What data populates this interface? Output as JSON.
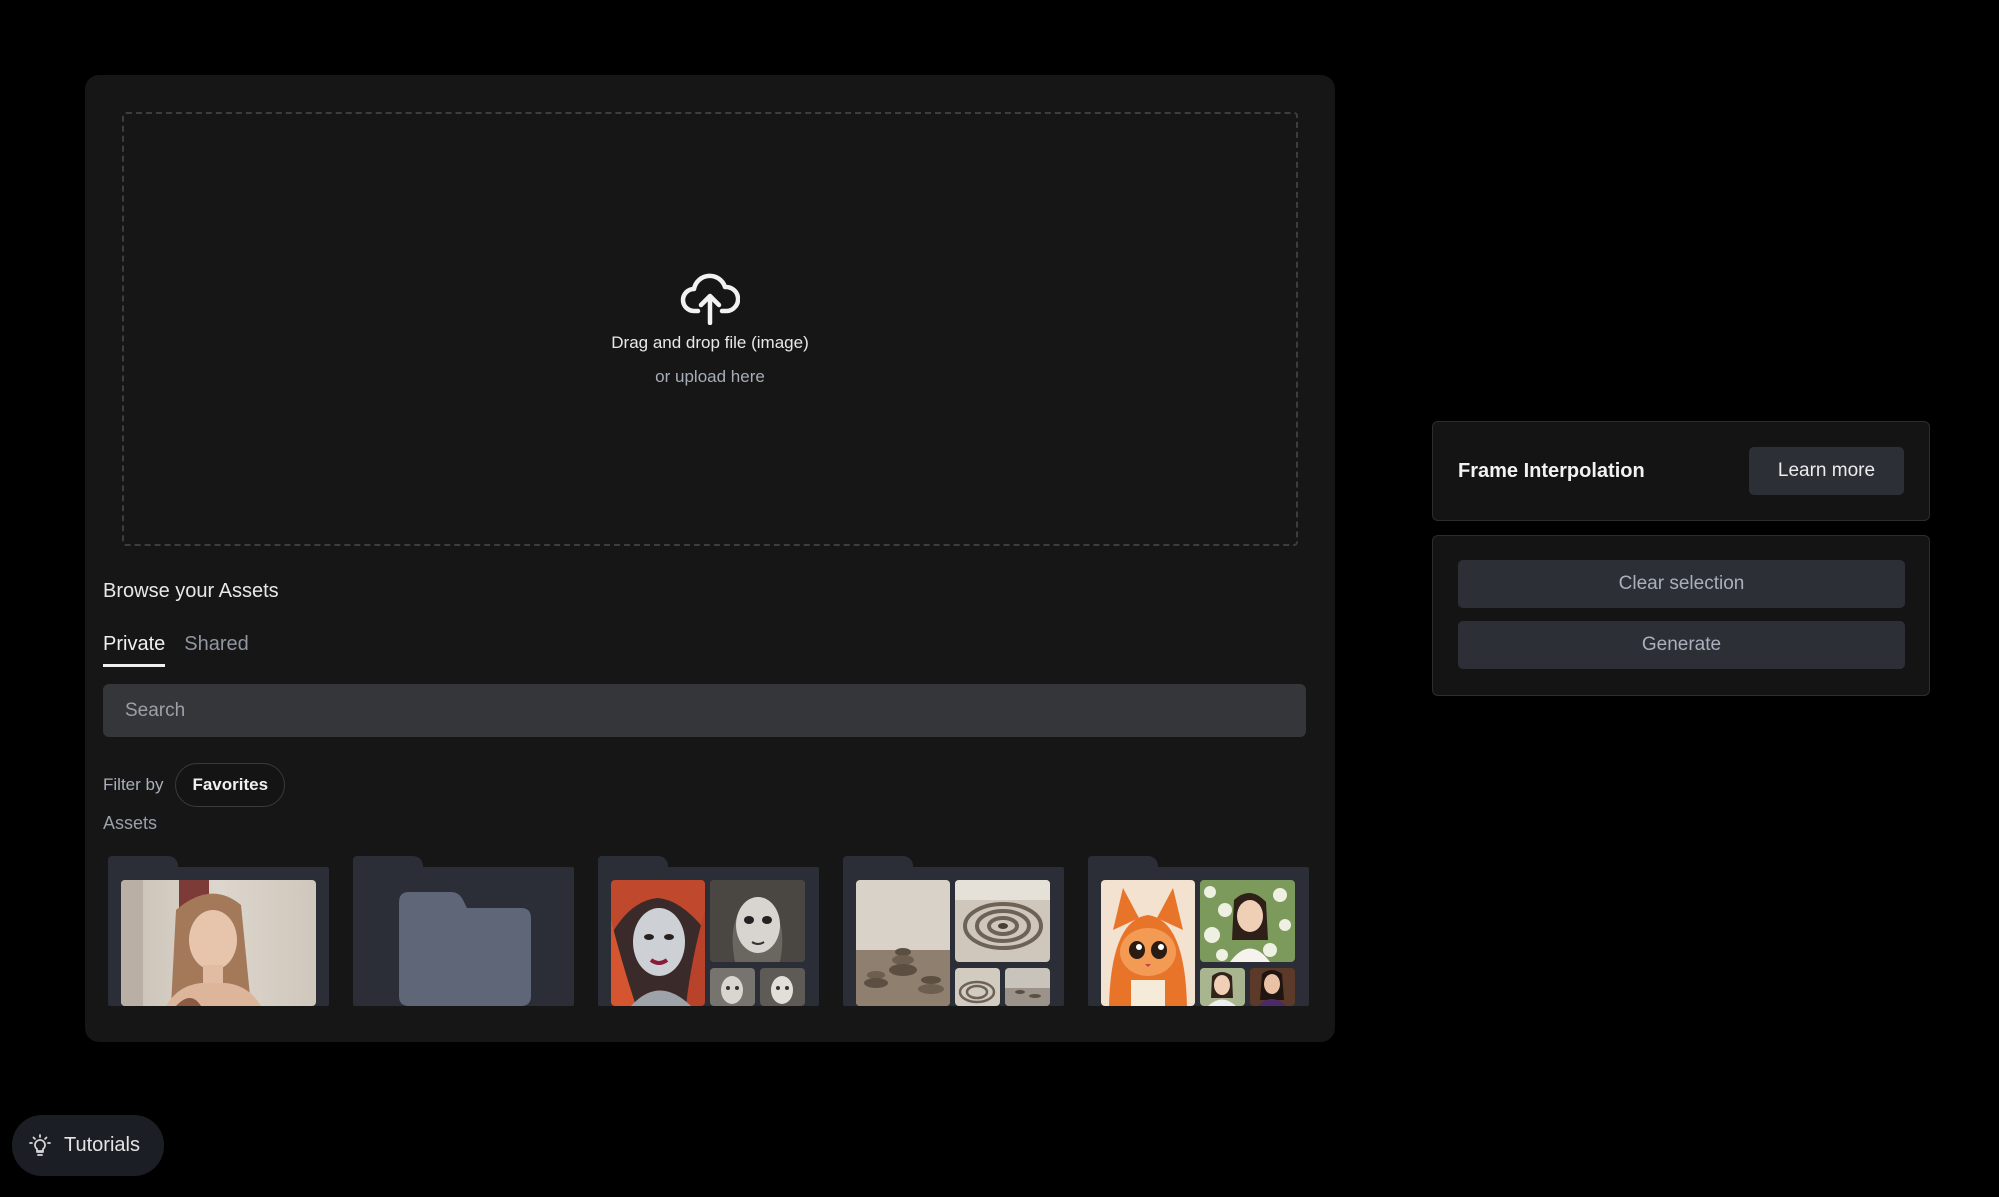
{
  "upload": {
    "title": "Drag and drop file (image)",
    "subtitle": "or upload here",
    "icon": "cloud-upload-icon"
  },
  "assets": {
    "heading": "Browse your Assets",
    "tabs": [
      {
        "label": "Private",
        "active": true
      },
      {
        "label": "Shared",
        "active": false
      }
    ],
    "search_placeholder": "Search",
    "filter_label": "Filter by",
    "filter_chip": "Favorites",
    "section_label": "Assets",
    "folders": [
      {
        "type": "single-image",
        "description": "woman portrait"
      },
      {
        "type": "empty-folder"
      },
      {
        "type": "image-grid"
      },
      {
        "type": "image-grid"
      },
      {
        "type": "image-grid"
      }
    ]
  },
  "frame_panel": {
    "title": "Frame Interpolation",
    "learn_more": "Learn more",
    "clear_selection": "Clear selection",
    "generate": "Generate"
  },
  "tutorials": {
    "label": "Tutorials",
    "icon": "lightbulb-icon"
  },
  "colors": {
    "background": "#000000",
    "panel": "#161616",
    "button": "#2c2f35",
    "muted_text": "#a9b0bb",
    "folder": "#2b2e36",
    "folder_icon": "#5f6677"
  }
}
